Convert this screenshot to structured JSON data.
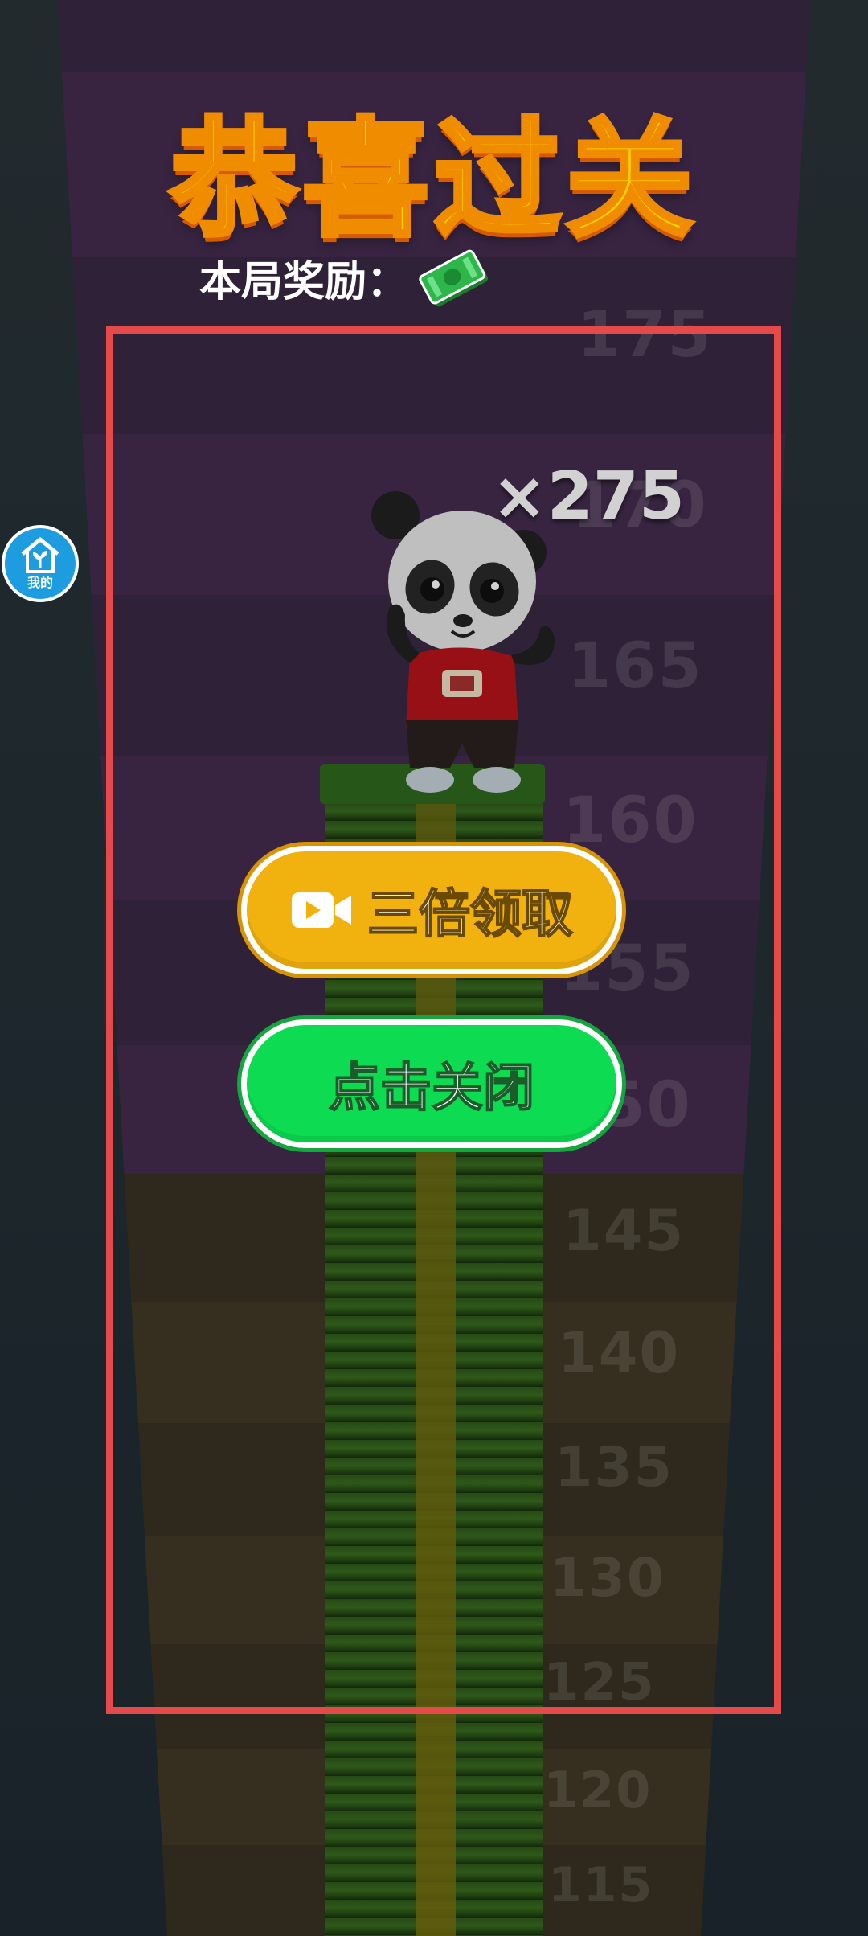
{
  "title": "恭喜过关",
  "reward": {
    "label": "本局奖励：",
    "icon": "cash-bundle-icon"
  },
  "multiplier": "×275",
  "side_button": {
    "label": "我的",
    "icon": "home-plant-icon"
  },
  "buttons": {
    "triple": {
      "label": "三倍领取",
      "icon": "video-camera-icon"
    },
    "close": {
      "label": "点击关闭"
    }
  },
  "tower_labels": [
    "175",
    "170",
    "165",
    "160",
    "155",
    "150",
    "145",
    "140",
    "135",
    "130",
    "125",
    "120",
    "115"
  ],
  "colors": {
    "title_fill": "#ffd200",
    "title_stroke": "#f08c00",
    "frame": "#e54a4a",
    "triple_button": "#f1b10f",
    "close_button": "#0ddc52",
    "home_button": "#1d9ce0"
  }
}
